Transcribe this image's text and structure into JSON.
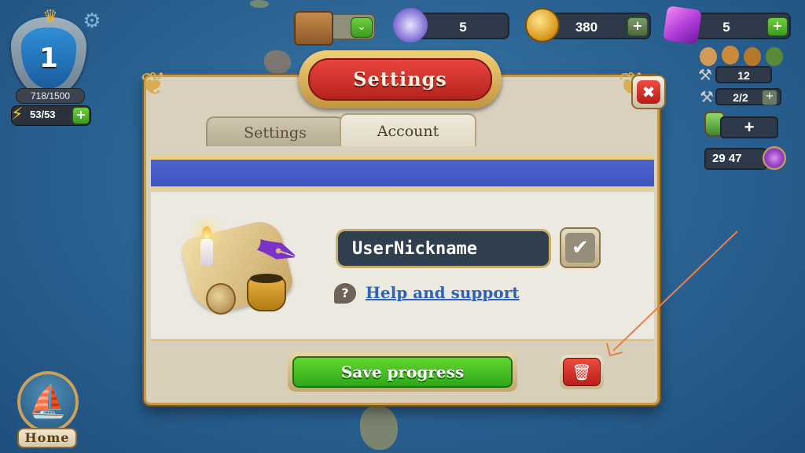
{
  "hud": {
    "level": "1",
    "xp": "718/1500",
    "energy": "53/53",
    "energy_plus": "+",
    "gear_icon": "⚙",
    "crown_icon": "♛",
    "bolt_icon": "⚡"
  },
  "resources": {
    "chest_dropdown_icon": "⌄",
    "orb_count": "5",
    "coins": "380",
    "coins_plus": "+",
    "gems": "5",
    "gems_plus": "+"
  },
  "side_panel": {
    "workers": "12",
    "tools": "2/2",
    "tools_plus": "+",
    "potion_plus": "+",
    "timer": "29 47"
  },
  "home": {
    "label": "Home",
    "ship_icon": "⛵"
  },
  "dialog": {
    "title": "Settings",
    "close_icon": "✖",
    "tabs": [
      {
        "label": "Settings",
        "active": false
      },
      {
        "label": "Account",
        "active": true
      }
    ],
    "nickname_value": "UserNickname",
    "confirm_icon": "✔",
    "help_icon": "?",
    "help_link": "Help and support",
    "save_button": "Save progress",
    "delete_icon": "🗑",
    "quill_icon": "✒"
  },
  "colors": {
    "sea": "#2c6596",
    "dialog_bg": "#d9d1bd",
    "title_red": "#d3332d",
    "band_blue": "#4c63cf",
    "save_green": "#3fbf22",
    "delete_red": "#d8302a",
    "link_blue": "#2e62b8",
    "annotation_arrow": "#e8804a"
  }
}
